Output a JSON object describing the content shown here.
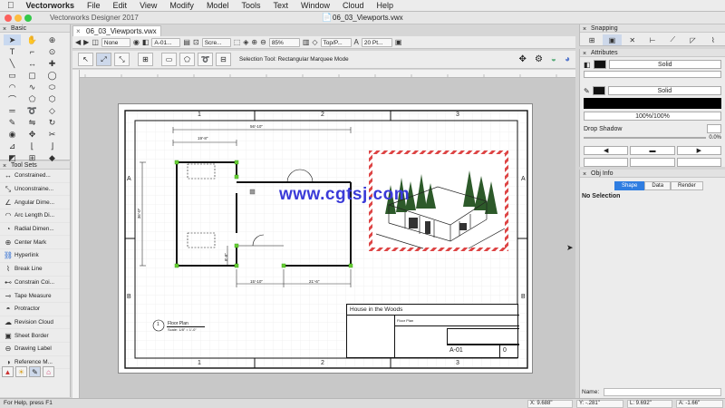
{
  "menubar": {
    "apple": "",
    "items": [
      "Vectorworks",
      "File",
      "Edit",
      "View",
      "Modify",
      "Model",
      "Tools",
      "Text",
      "Window",
      "Cloud",
      "Help"
    ]
  },
  "window": {
    "title": "Vectorworks Designer 2017",
    "document": "06_03_Viewports.vwx"
  },
  "doc_tab": "06_03_Viewports.vwx",
  "viewbar": {
    "class": "None",
    "layer": "A-01...",
    "view": "Scre...",
    "zoom": "85%",
    "plane": "Top/P...",
    "font_size": "20 Pt..."
  },
  "modebar": {
    "hint": "Selection Tool: Rectangular Marquee Mode"
  },
  "basic_palette": {
    "title": "Basic"
  },
  "toolsets": {
    "title": "Tool Sets",
    "items": [
      "Constrained...",
      "Unconstraine...",
      "Angular Dime...",
      "Arc Length Di...",
      "Radial Dimen...",
      "Center Mark",
      "Hyperlink",
      "Break Line",
      "Constrain Coi...",
      "Tape Measure",
      "Protractor",
      "Revision Cloud",
      "Sheet Border",
      "Drawing Label",
      "Reference M..."
    ]
  },
  "sheet": {
    "cols": [
      "1",
      "2",
      "3"
    ],
    "rows": [
      "A",
      "B"
    ],
    "dims": {
      "overall_width": "56'-10\"",
      "left_wing": "19'-8\"",
      "overall_depth": "36'-0\"",
      "small_depth": "8'-8\"",
      "bottom_left": "15'-10\"",
      "bottom_right": "21'-6\""
    },
    "drawing_label": {
      "number": "1",
      "name": "Floor Plan",
      "scale": "Scale: 1/8\" = 1'-0\""
    },
    "title_block": {
      "project": "House in the Woods",
      "sheet_title": "Floor Plan",
      "sheet_number": "A-01",
      "revision": "0"
    },
    "watermark": "www.cgtsj.com"
  },
  "snapping": {
    "title": "Snapping"
  },
  "attributes": {
    "title": "Attributes",
    "fill": "Solid",
    "pen": "Solid",
    "opacity": "100%/100%",
    "drop_shadow": "Drop Shadow",
    "offset": "0.0%"
  },
  "obj_info": {
    "title": "Obj Info",
    "tabs": [
      "Shape",
      "Data",
      "Render"
    ],
    "selection": "No Selection",
    "name_label": "Name:"
  },
  "status": {
    "help": "For Help, press F1",
    "x": "X: 9.688\"",
    "y": "Y: -.281\"",
    "l": "L: 9.692\"",
    "a": "A: -1.66\""
  }
}
